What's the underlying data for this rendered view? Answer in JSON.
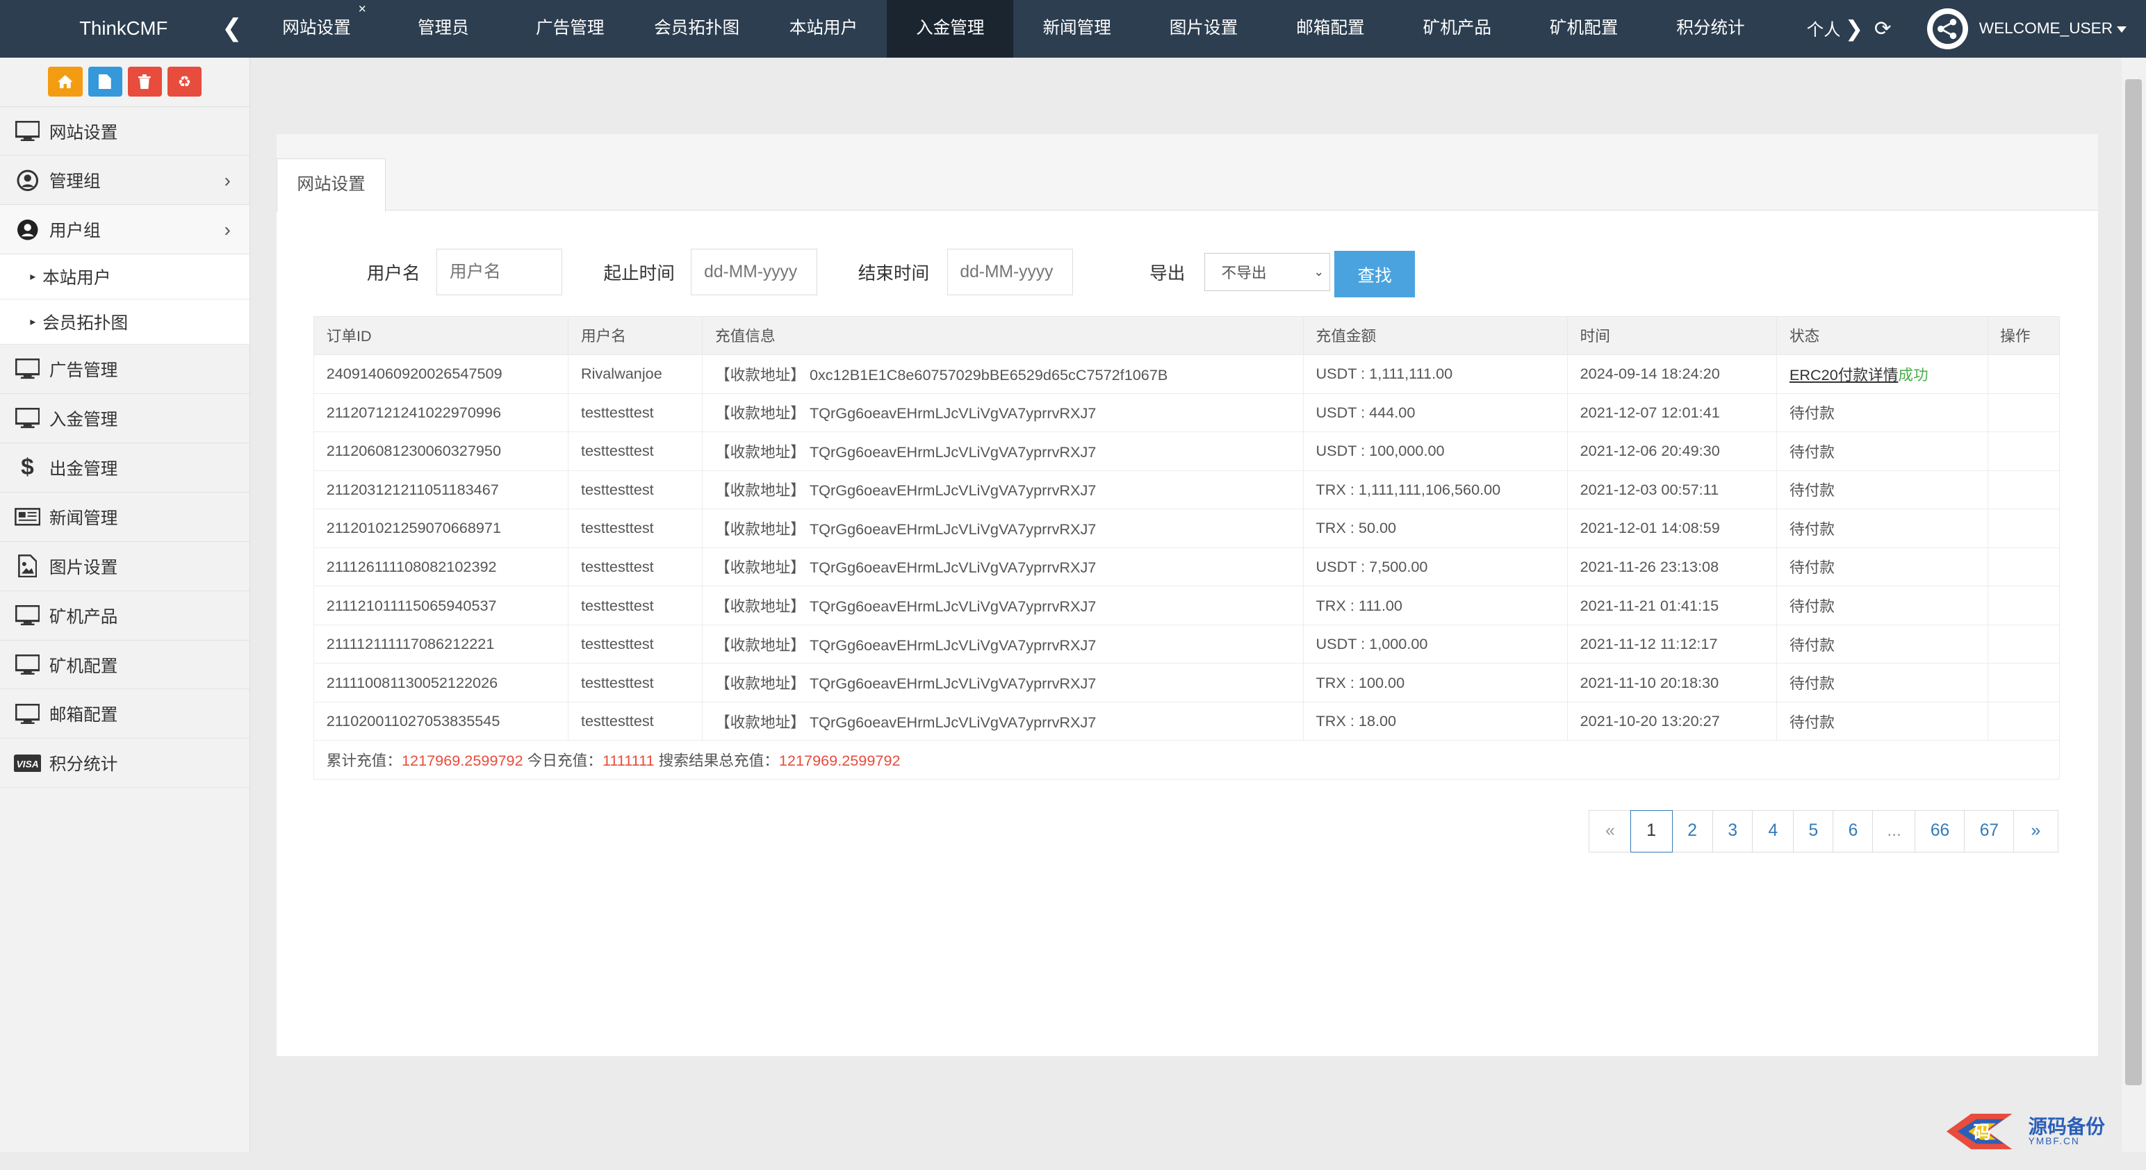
{
  "topbar": {
    "brand": "ThinkCMF",
    "tabs": [
      {
        "label": "网站设置",
        "close": "×"
      },
      {
        "label": "管理员"
      },
      {
        "label": "广告管理"
      },
      {
        "label": "会员拓扑图"
      },
      {
        "label": "本站用户"
      },
      {
        "label": "入金管理"
      },
      {
        "label": "新闻管理"
      },
      {
        "label": "图片设置"
      },
      {
        "label": "邮箱配置"
      },
      {
        "label": "矿机产品"
      },
      {
        "label": "矿机配置"
      },
      {
        "label": "积分统计"
      }
    ],
    "overflow_tab": "个人",
    "user_label": "WELCOME_USER"
  },
  "sidebar": {
    "items": [
      {
        "label": "网站设置",
        "icon": "monitor-icon"
      },
      {
        "label": "管理组",
        "icon": "user-circle-icon"
      },
      {
        "label": "用户组",
        "icon": "user-circle-icon"
      },
      {
        "label": "广告管理",
        "icon": "monitor-icon"
      },
      {
        "label": "入金管理",
        "icon": "monitor-icon"
      },
      {
        "label": "出金管理",
        "icon": "dollar-icon"
      },
      {
        "label": "新闻管理",
        "icon": "newspaper-icon"
      },
      {
        "label": "图片设置",
        "icon": "image-icon"
      },
      {
        "label": "矿机产品",
        "icon": "monitor-icon"
      },
      {
        "label": "矿机配置",
        "icon": "monitor-icon"
      },
      {
        "label": "邮箱配置",
        "icon": "monitor-icon"
      },
      {
        "label": "积分统计",
        "icon": "visa-icon"
      }
    ],
    "subitems": [
      {
        "label": "本站用户"
      },
      {
        "label": "会员拓扑图"
      }
    ]
  },
  "panel": {
    "tab_label": "网站设置"
  },
  "search": {
    "username_label": "用户名",
    "username_placeholder": "用户名",
    "start_label": "起止时间",
    "start_placeholder": "dd-MM-yyyy",
    "end_label": "结束时间",
    "end_placeholder": "dd-MM-yyyy",
    "export_label": "导出",
    "export_value": "不导出",
    "submit_label": "查找"
  },
  "table": {
    "headers": [
      "订单ID",
      "用户名",
      "充值信息",
      "充值金额",
      "时间",
      "状态",
      "操作"
    ],
    "rows": [
      {
        "id": "240914060920026547509",
        "user": "Rivalwanjoe",
        "info": "【收款地址】 0xc12B1E1C8e60757029bBE6529d65cC7572f1067B",
        "amount": "USDT : 1,111,111.00",
        "time": "2024-09-14 18:24:20",
        "status": "ERC20付款详情",
        "status_extra": "成功"
      },
      {
        "id": "211207121241022970996",
        "user": "testtesttest",
        "info": "【收款地址】 TQrGg6oeavEHrmLJcVLiVgVA7yprrvRXJ7",
        "amount": "USDT : 444.00",
        "time": "2021-12-07 12:01:41",
        "status": "待付款",
        "status_extra": ""
      },
      {
        "id": "211206081230060327950",
        "user": "testtesttest",
        "info": "【收款地址】 TQrGg6oeavEHrmLJcVLiVgVA7yprrvRXJ7",
        "amount": "USDT : 100,000.00",
        "time": "2021-12-06 20:49:30",
        "status": "待付款",
        "status_extra": ""
      },
      {
        "id": "211203121211051183467",
        "user": "testtesttest",
        "info": "【收款地址】 TQrGg6oeavEHrmLJcVLiVgVA7yprrvRXJ7",
        "amount": "TRX : 1,111,111,106,560.00",
        "time": "2021-12-03 00:57:11",
        "status": "待付款",
        "status_extra": ""
      },
      {
        "id": "211201021259070668971",
        "user": "testtesttest",
        "info": "【收款地址】 TQrGg6oeavEHrmLJcVLiVgVA7yprrvRXJ7",
        "amount": "TRX : 50.00",
        "time": "2021-12-01 14:08:59",
        "status": "待付款",
        "status_extra": ""
      },
      {
        "id": "211126111108082102392",
        "user": "testtesttest",
        "info": "【收款地址】 TQrGg6oeavEHrmLJcVLiVgVA7yprrvRXJ7",
        "amount": "USDT : 7,500.00",
        "time": "2021-11-26 23:13:08",
        "status": "待付款",
        "status_extra": ""
      },
      {
        "id": "211121011115065940537",
        "user": "testtesttest",
        "info": "【收款地址】 TQrGg6oeavEHrmLJcVLiVgVA7yprrvRXJ7",
        "amount": "TRX : 111.00",
        "time": "2021-11-21 01:41:15",
        "status": "待付款",
        "status_extra": ""
      },
      {
        "id": "211112111117086212221",
        "user": "testtesttest",
        "info": "【收款地址】 TQrGg6oeavEHrmLJcVLiVgVA7yprrvRXJ7",
        "amount": "USDT : 1,000.00",
        "time": "2021-11-12 11:12:17",
        "status": "待付款",
        "status_extra": ""
      },
      {
        "id": "211110081130052122026",
        "user": "testtesttest",
        "info": "【收款地址】 TQrGg6oeavEHrmLJcVLiVgVA7yprrvRXJ7",
        "amount": "TRX : 100.00",
        "time": "2021-11-10 20:18:30",
        "status": "待付款",
        "status_extra": ""
      },
      {
        "id": "211020011027053835545",
        "user": "testtesttest",
        "info": "【收款地址】 TQrGg6oeavEHrmLJcVLiVgVA7yprrvRXJ7",
        "amount": "TRX : 18.00",
        "time": "2021-10-20 13:20:27",
        "status": "待付款",
        "status_extra": ""
      }
    ],
    "summary": {
      "total_label": "累计充值：",
      "total_value": "1217969.2599792",
      "today_label": " 今日充值：",
      "today_value": "1111111",
      "search_label": " 搜索结果总充值：",
      "search_value": "1217969.2599792"
    }
  },
  "pagination": {
    "items": [
      "«",
      "1",
      "2",
      "3",
      "4",
      "5",
      "6",
      "...",
      "66",
      "67",
      "»"
    ],
    "active": "1"
  },
  "watermark": {
    "logo_char": "码",
    "cn": "源码备份",
    "en": "YMBF.CN"
  },
  "colors": {
    "topbar": "#2c3e50",
    "accent_button": "#4aa3df",
    "highlight_red": "#e74c3c",
    "success_green": "#4cae4c",
    "link_blue": "#337ab7"
  }
}
